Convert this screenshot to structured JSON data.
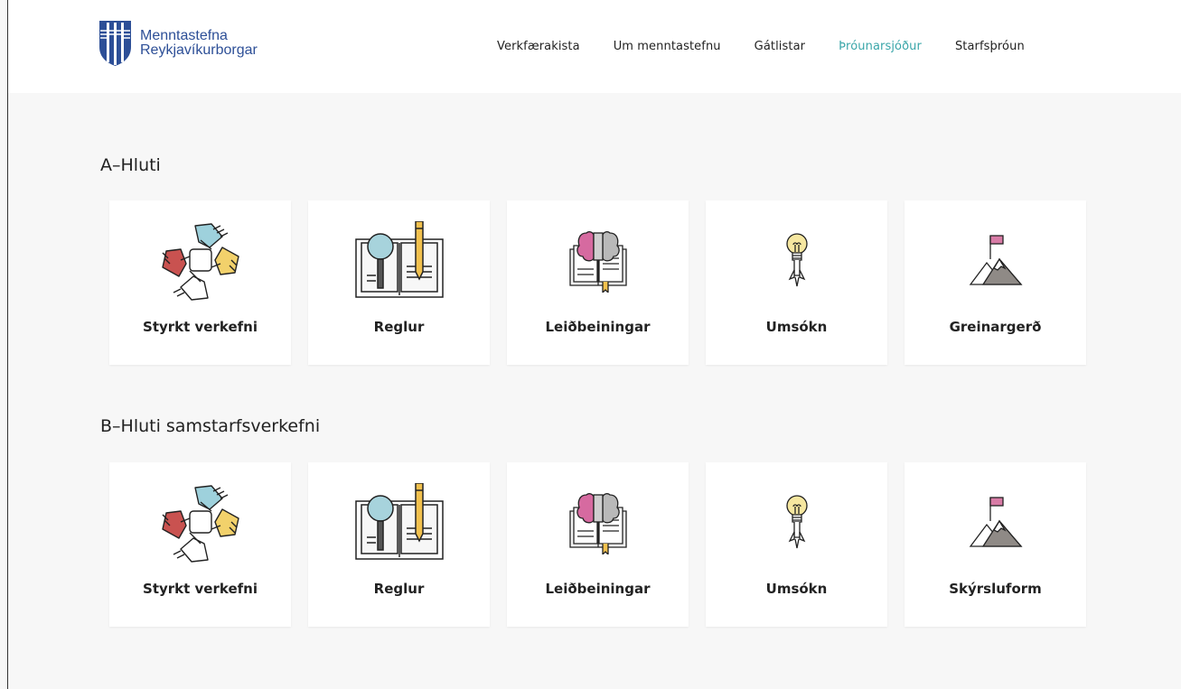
{
  "colors": {
    "brand": "#2d4f97",
    "accent": "#3aa6a9",
    "background": "#f7f7f7"
  },
  "header": {
    "logo_line1": "Menntastefna",
    "logo_line2": "Reykjavíkurborgar",
    "logo_icon": "reykjavik-crest-icon",
    "nav": [
      {
        "label": "Verkfærakista",
        "active": false
      },
      {
        "label": "Um menntastefnu",
        "active": false
      },
      {
        "label": "Gátlistar",
        "active": false
      },
      {
        "label": "Þróunarsjóður",
        "active": true
      },
      {
        "label": "Starfsþróun",
        "active": false
      }
    ]
  },
  "sections": [
    {
      "title": "A–Hluti",
      "cards": [
        {
          "label": "Styrkt verkefni",
          "icon": "hands-teamwork-icon"
        },
        {
          "label": "Reglur",
          "icon": "book-magnifier-pencil-icon"
        },
        {
          "label": "Leiðbeiningar",
          "icon": "book-brain-icon"
        },
        {
          "label": "Umsókn",
          "icon": "lightbulb-rocket-icon"
        },
        {
          "label": "Greinargerð",
          "icon": "mountain-flag-icon"
        }
      ]
    },
    {
      "title": "B–Hluti samstarfsverkefni",
      "cards": [
        {
          "label": "Styrkt verkefni",
          "icon": "hands-teamwork-icon"
        },
        {
          "label": "Reglur",
          "icon": "book-magnifier-pencil-icon"
        },
        {
          "label": "Leiðbeiningar",
          "icon": "book-brain-icon"
        },
        {
          "label": "Umsókn",
          "icon": "lightbulb-rocket-icon"
        },
        {
          "label": "Skýrsluform",
          "icon": "mountain-flag-icon"
        }
      ]
    }
  ]
}
